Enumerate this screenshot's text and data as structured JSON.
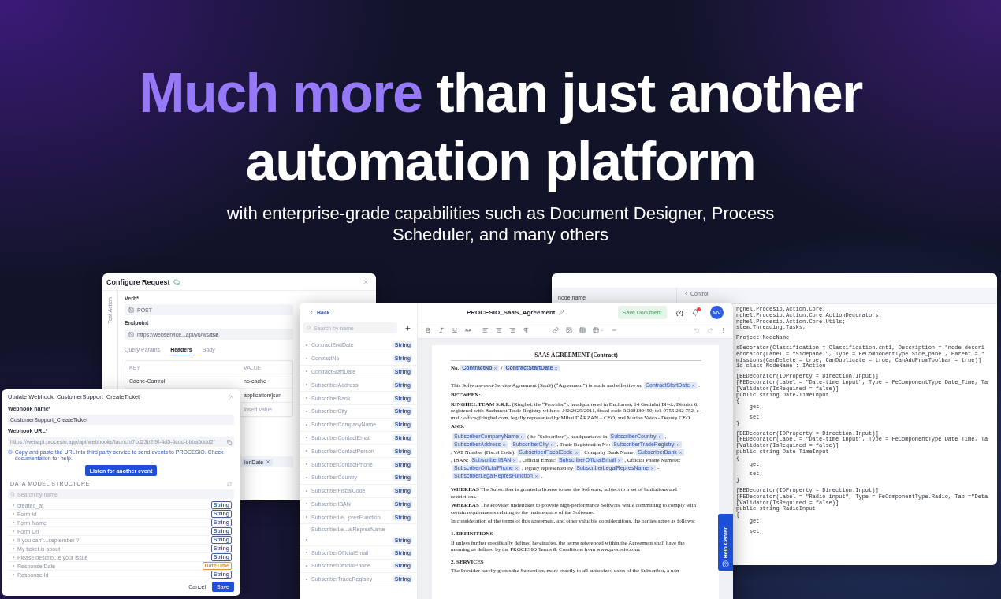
{
  "hero": {
    "headline_accent": "Much more",
    "headline_rest": "than just another",
    "headline_line2": "automation platform",
    "subtitle": "with enterprise-grade capabilities such as Document Designer, Process Scheduler, and many others"
  },
  "configure_request": {
    "title": "Configure Request",
    "side_tab": "Test Action",
    "verb_label": "Verb*",
    "verb": "POST",
    "endpoint_label": "Endpoint",
    "endpoint": "https://webservice...api/v6/ws/**tsa**",
    "tabs": [
      {
        "label": "Query Params",
        "selected": false
      },
      {
        "label": "Headers",
        "selected": true
      },
      {
        "label": "Body",
        "selected": false
      }
    ],
    "columns": [
      "KEY",
      "VALUE"
    ],
    "rows": [
      {
        "key": "Cache-Control",
        "value": "no-cache"
      },
      {
        "value": "application/json"
      },
      {
        "placeholder": "Insert value"
      }
    ],
    "tag": "ionDate"
  },
  "webhook": {
    "title": "Update Webhook: CustomerSupport_CreateTicket",
    "name_label": "Webhook name*",
    "name": "CustomerSupport_CreateTicket",
    "url_label": "Webhook URL*",
    "url": "https://webapi.procesio.app/api/webhooks/launch/7cd23b2f9f-4d5-4cdc-bbba5ddd2f",
    "info": "Copy and paste the URL into third party service to send events to PROCESIO. Check documentation for help.",
    "listen_button": "Listen for another event",
    "section": "DATA MODEL STRUCTURE",
    "search_placeholder": "Search by name",
    "fields": [
      {
        "name": "created_at",
        "type": "String",
        "color": "#4a5f8f"
      },
      {
        "name": "Form Id",
        "type": "String",
        "color": "#4a5f8f"
      },
      {
        "name": "Form Name",
        "type": "String",
        "color": "#4a5f8f"
      },
      {
        "name": "Form Url",
        "type": "String",
        "color": "#4a5f8f"
      },
      {
        "name": "If you can't...september ?",
        "type": "String",
        "color": "#4a5f8f"
      },
      {
        "name": "My ticket is about",
        "type": "String",
        "color": "#4a5f8f"
      },
      {
        "name": "Please describ...e your issue",
        "type": "String",
        "color": "#4a5f8f"
      },
      {
        "name": "Response Date",
        "type": "DateTime",
        "color": "#e8912d"
      },
      {
        "name": "Response Id",
        "type": "String",
        "color": "#4a5f8f"
      }
    ],
    "cancel": "Cancel",
    "save": "Save"
  },
  "code_editor": {
    "node_label": "node name",
    "back": "Control",
    "blocks": [
      [
        "nghel.Procesio.Action.Core;",
        "nghel.Procesio.Action.Core.ActionDecorators;",
        "nghel.Procesio.Action.Core.Utils;",
        "stem.Threading.Tasks;"
      ],
      [
        "Project.NodeName"
      ],
      [
        "sDecorator(Classification = Classification.cnt1, Description = \"node descri",
        "ecorator(Label = \"Sidepanel\", Type = FeComponentType.Side_panel, Parent = \"",
        "missions(CanDelete = true, CanDuplicate = true, CanAddFromToolbar = true)]",
        "ic class NodeName : IAction"
      ],
      [
        "[BEDecorator(IOProperty = Direction.Input)]",
        "[FEDecorator(Label = \"Date-time input\", Type = FeComponentType.Date_Time, Ta",
        "[Validator(IsRequired = false)]",
        "public string Date-TimeInput",
        "{",
        "    get;"
      ],
      [
        "    set;",
        "}"
      ],
      [
        "[BEDecorator(IOProperty = Direction.Input)]",
        "[FEDecorator(Label = \"Date-time input\", Type = FeComponentType.Date_Time, Ta",
        "[Validator(IsRequired = false)]",
        "public string Date-TimeInput",
        "{",
        "    get;"
      ],
      [
        "    set;",
        "}"
      ],
      [
        "[BEDecorator(IOProperty = Direction.Input)]",
        "[FEDecorator(Label = \"Radio input\", Type = FeComponentType.Radio, Tab =\"Deta",
        "[Validator(IsRequired = false)]",
        "public string RadioInput",
        "{",
        "    get;"
      ],
      [
        "    set;"
      ]
    ]
  },
  "editor": {
    "back": "Back",
    "title": "PROCESIO_SaaS_Agreement",
    "save": "Save Document",
    "variables_button": "{x}",
    "avatar": "MV",
    "search_placeholder": "Search by name",
    "variables": [
      {
        "name": "ContractEndDate",
        "type": "String",
        "kind": "inline"
      },
      {
        "name": "ContractNo",
        "type": "String",
        "kind": "inline"
      },
      {
        "name": "ContractStartDate",
        "type": "String",
        "kind": "inline"
      },
      {
        "name": "SubscriberAddress",
        "type": "String",
        "kind": "inline"
      },
      {
        "name": "SubscriberBank",
        "type": "String",
        "kind": "inline"
      },
      {
        "name": "SubscriberCity",
        "type": "String",
        "kind": "inline"
      },
      {
        "name": "SubscriberCompanyName",
        "type": "String",
        "kind": "inline"
      },
      {
        "name": "SubscriberContactEmail",
        "type": "String",
        "kind": "inline"
      },
      {
        "name": "SubscriberContactPerson",
        "type": "String",
        "kind": "inline"
      },
      {
        "name": "SubscriberContactPhone",
        "type": "String",
        "kind": "inline"
      },
      {
        "name": "SubscriberCountry",
        "type": "String",
        "kind": "inline"
      },
      {
        "name": "SubscriberFiscalCode",
        "type": "String",
        "kind": "inline"
      },
      {
        "name": "SubscriberIBAN",
        "type": "String",
        "kind": "inline"
      },
      {
        "name": "SubscriberLe...presFunction",
        "type": "String",
        "kind": "inline"
      },
      {
        "name": "SubscriberLe...alRepresName",
        "type": "String",
        "kind": "stacked"
      },
      {
        "name": "SubscriberOfficialEmail",
        "type": "String",
        "kind": "inline"
      },
      {
        "name": "SubscriberOfficialPhone",
        "type": "String",
        "kind": "inline"
      },
      {
        "name": "SubscriberTradeRegistry",
        "type": "String",
        "kind": "inline"
      }
    ],
    "document": [
      {
        "kind": "title",
        "text": "SAAS AGREEMENT (Contract)"
      },
      {
        "kind": "number_line",
        "segments": [
          {
            "kind": "text",
            "text": "No."
          },
          {
            "kind": "field",
            "text": "ContractNo"
          },
          {
            "kind": "text",
            "text": "/"
          },
          {
            "kind": "field",
            "text": "ContractStartDate"
          }
        ]
      },
      {
        "kind": "para",
        "segments": [
          {
            "kind": "text",
            "text": "This Software-as-a-Service Agreement (SaaS) (“Agreement”) is made and effective on"
          },
          {
            "kind": "field",
            "text": "ContractStartDate"
          },
          {
            "kind": "text",
            "text": "."
          }
        ]
      },
      {
        "kind": "label",
        "text": "BETWEEN:"
      },
      {
        "kind": "para",
        "text": "**RINGHEL TEAM S.R.L.** (Ringhel, the “Provider”), headquartered in Bucharest, 14 Geniului Blvd., District 6, registered with Bucharest Trade Registry with no. J40/2629/2011, fiscal code RO28139450, tel. 0755 262 752, e-mail: office@ringhel.com, legally represented by Mihai DĂRZAN – CEO, and Marian Voica - Deputy CEO"
      },
      {
        "kind": "label",
        "text": "AND:"
      },
      {
        "kind": "para",
        "segments": [
          {
            "kind": "field",
            "text": "SubscriberCompanyName"
          },
          {
            "kind": "text",
            "text": "(the “Subscriber”), headquartered in"
          },
          {
            "kind": "field",
            "text": "SubscriberCountry"
          },
          {
            "kind": "text",
            "text": ","
          },
          {
            "kind": "field",
            "text": "SubscriberAddress"
          },
          {
            "kind": "field",
            "text": "SubscriberCity"
          },
          {
            "kind": "text",
            "text": ", Trade Registration No:"
          },
          {
            "kind": "field",
            "text": "SubscriberTradeRegistry"
          },
          {
            "kind": "text",
            "text": ", VAT Number (Fiscal Code):"
          },
          {
            "kind": "field",
            "text": "SubscriberFiscalCode"
          },
          {
            "kind": "text",
            "text": ", Company Bank Name:"
          },
          {
            "kind": "field",
            "text": "SubscriberBank"
          },
          {
            "kind": "text",
            "text": ", IBAN:"
          },
          {
            "kind": "field",
            "text": "SubscriberIBAN"
          },
          {
            "kind": "text",
            "text": ", Official Email:"
          },
          {
            "kind": "field",
            "text": "SubscriberOfficialEmail"
          },
          {
            "kind": "text",
            "text": ", Official Phone Number:"
          },
          {
            "kind": "field",
            "text": "SubscriberOfficialPhone"
          },
          {
            "kind": "text",
            "text": ", legally represented by"
          },
          {
            "kind": "field",
            "text": "SubscriberLegalRepresName"
          },
          {
            "kind": "text",
            "text": "-"
          },
          {
            "kind": "field",
            "text": "SubscriberLegalRepresFunction"
          },
          {
            "kind": "text",
            "text": "."
          }
        ]
      },
      {
        "kind": "para_spaced",
        "text": "**WHEREAS** The Subscriber is granted a license to use the Software, subject to a set of limitations and restrictions."
      },
      {
        "kind": "para",
        "text": "**WHEREAS** The Provider undertakes to provide high-performance Software while committing to comply with certain requirements relating to the maintenance of the Software."
      },
      {
        "kind": "para",
        "text": "In consideration of the terms of this agreement, and other valuable considerations, the parties agree as follows:"
      },
      {
        "kind": "heading",
        "text": "1. DEFINITIONS"
      },
      {
        "kind": "para",
        "text": "If unless further specifically defined hereinafter, the terms referenced within the Agreement shall have the meaning as defined by the PROCESIO Terms & Conditions from www.procesio.com."
      },
      {
        "kind": "heading",
        "text": "2. SERVICES"
      },
      {
        "kind": "para",
        "text": "The Provider hereby grants the Subscriber, more exactly to all authorized users of the Subscriber, a non-"
      }
    ]
  },
  "help_center": "Help Center"
}
